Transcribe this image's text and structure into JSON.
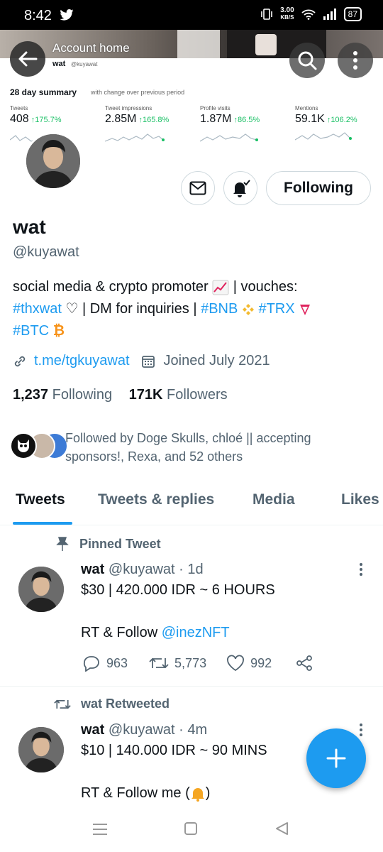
{
  "status_bar": {
    "time": "8:42",
    "net_speed": "3.00",
    "net_unit": "KB/S",
    "battery": "87"
  },
  "header": {
    "title": "Account home",
    "account_name": "wat",
    "account_handle": "@kuyawat"
  },
  "summary": {
    "title": "28 day summary",
    "subtitle": "with change over previous period",
    "stats": [
      {
        "label": "Tweets",
        "value": "408",
        "change": "175.7%"
      },
      {
        "label": "Tweet impressions",
        "value": "2.85M",
        "change": "165.8%"
      },
      {
        "label": "Profile visits",
        "value": "1.87M",
        "change": "86.5%"
      },
      {
        "label": "Mentions",
        "value": "59.1K",
        "change": "106.2%"
      }
    ]
  },
  "profile": {
    "follow_button": "Following",
    "name": "wat",
    "handle": "@kuyawat",
    "bio_line1": "social media & crypto promoter",
    "bio_line1b": " | vouches:",
    "bio_tag1": "#thxwat",
    "bio_line2": " ♡ | DM for inquiries | ",
    "bio_tag2": "#BNB",
    "bio_tag3": "#TRX",
    "bio_tag4": "#BTC",
    "link": "t.me/tgkuyawat",
    "joined": "Joined July 2021",
    "following_count": "1,237",
    "following_label": "Following",
    "followers_count": "171K",
    "followers_label": "Followers",
    "followed_by": "Followed by Doge Skulls, chloé || accepting sponsors!, Rexa, and 52 others"
  },
  "tabs": [
    "Tweets",
    "Tweets & replies",
    "Media",
    "Likes"
  ],
  "tweets": [
    {
      "context": "Pinned Tweet",
      "name": "wat",
      "handle": "@kuyawat",
      "time": "· 1d",
      "line1": "$30 | 420.000 IDR ~ 6 HOURS",
      "line2": "RT & Follow ",
      "mention": "@inezNFT",
      "replies": "963",
      "retweets": "5,773",
      "likes": "992"
    },
    {
      "context": "wat Retweeted",
      "name": "wat",
      "handle": "@kuyawat",
      "time": "· 4m",
      "line1": "$10 | 140.000 IDR ~ 90 MINS",
      "line2": "RT & Follow me (",
      "line2_end": ")"
    }
  ],
  "colors": {
    "accent": "#1d9bf0",
    "positive": "#17bf63",
    "muted": "#536471"
  }
}
